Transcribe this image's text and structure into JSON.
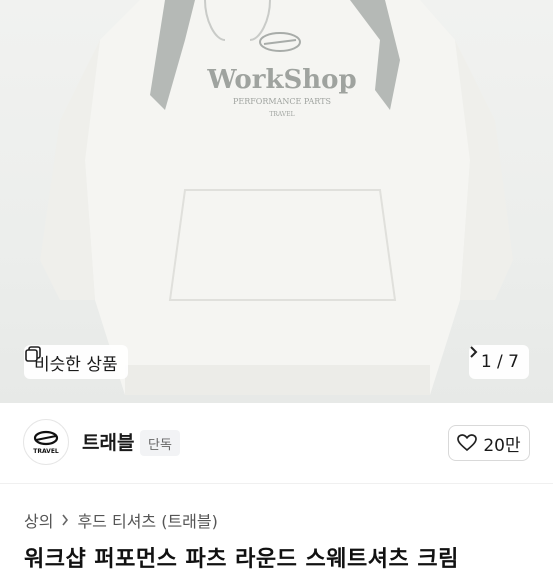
{
  "product_image": {
    "print_brand": "WorkShop",
    "print_line1": "PERFORMANCE PARTS",
    "print_line2": "TRAVEL"
  },
  "image_overlay": {
    "similar_button_label": "비슷한 상품",
    "image_counter": "1 / 7"
  },
  "seller": {
    "logo_text": "TRAVEL",
    "name": "트래블",
    "badge": "단독",
    "likes_label": "20만"
  },
  "breadcrumb": {
    "items": [
      "상의",
      "후드 티셔츠 (트래블)"
    ]
  },
  "product": {
    "title_partial": "워크샵 퍼포먼스 파츠 라운드 스웨트셔츠 크림"
  },
  "colors": {
    "accent_gray": "#aeb3b0",
    "sweatshirt": "#f3f3ef"
  }
}
